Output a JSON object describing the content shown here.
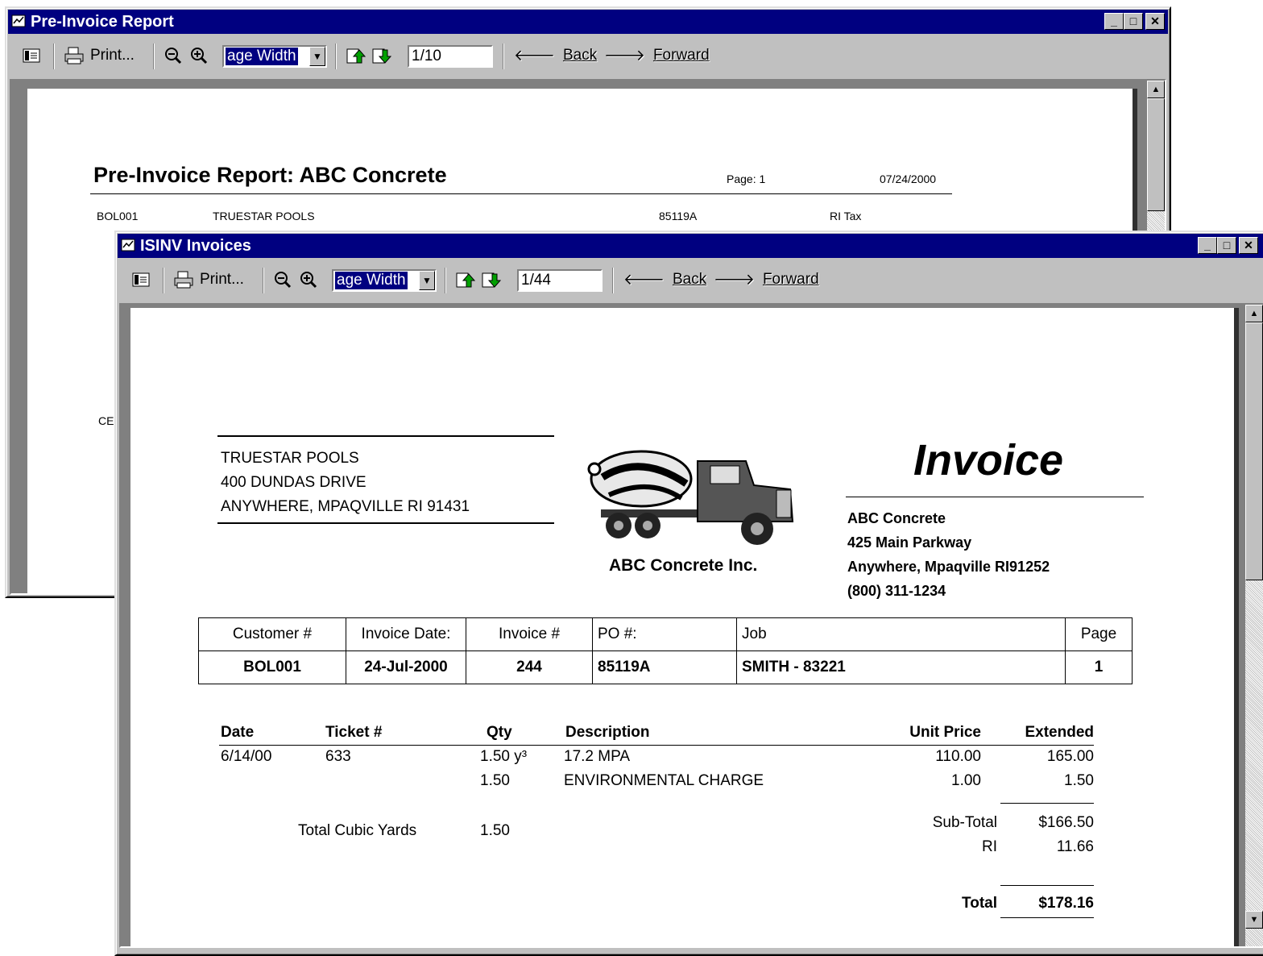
{
  "back_window": {
    "title": "Pre-Invoice Report",
    "toolbar": {
      "print_label": "Print...",
      "zoom_value": "age Width",
      "page_value": "1/10",
      "back_label": "Back",
      "forward_label": "Forward"
    },
    "report": {
      "title": "Pre-Invoice Report:  ABC Concrete",
      "page_label": "Page:  1",
      "date": "07/24/2000",
      "row": {
        "customer": "BOL001",
        "name": "TRUESTAR POOLS",
        "po": "85119A",
        "tax": "RI Tax"
      },
      "partial": "CE"
    }
  },
  "front_window": {
    "title": "ISINV Invoices",
    "toolbar": {
      "print_label": "Print...",
      "zoom_value": "age Width",
      "page_value": "1/44",
      "back_label": "Back",
      "forward_label": "Forward"
    },
    "invoice": {
      "bill_to": [
        "TRUESTAR POOLS",
        "400 DUNDAS DRIVE",
        "ANYWHERE, MPAQVILLE  RI  91431"
      ],
      "logo_caption": "ABC Concrete Inc.",
      "heading": "Invoice",
      "company": [
        "ABC Concrete",
        "425 Main Parkway",
        "Anywhere, Mpaqville RI91252",
        "(800) 311-1234"
      ],
      "info_headers": [
        "Customer #",
        "Invoice Date:",
        "Invoice #",
        "PO #:",
        "Job",
        "Page"
      ],
      "info_values": [
        "BOL001",
        "24-Jul-2000",
        "244",
        "85119A",
        "SMITH - 83221",
        "1"
      ],
      "line_headers": {
        "date": "Date",
        "ticket": "Ticket #",
        "qty": "Qty",
        "description": "Description",
        "unit_price": "Unit Price",
        "extended": "Extended"
      },
      "lines": [
        {
          "date": "6/14/00",
          "ticket": "633",
          "qty": "1.50  y³",
          "description": "17.2 MPA",
          "unit_price": "110.00",
          "extended": "165.00"
        },
        {
          "date": "",
          "ticket": "",
          "qty": "1.50",
          "description": "ENVIRONMENTAL CHARGE",
          "unit_price": "1.00",
          "extended": "1.50"
        }
      ],
      "total_cy_label": "Total Cubic Yards",
      "total_cy_value": "1.50",
      "subtotal_label": "Sub-Total",
      "subtotal_value": "$166.50",
      "tax_label": "RI",
      "tax_value": "11.66",
      "total_label": "Total",
      "total_value": "$178.16"
    }
  },
  "colors": {
    "titlebar": "#000080",
    "face": "#c0c0c0"
  }
}
